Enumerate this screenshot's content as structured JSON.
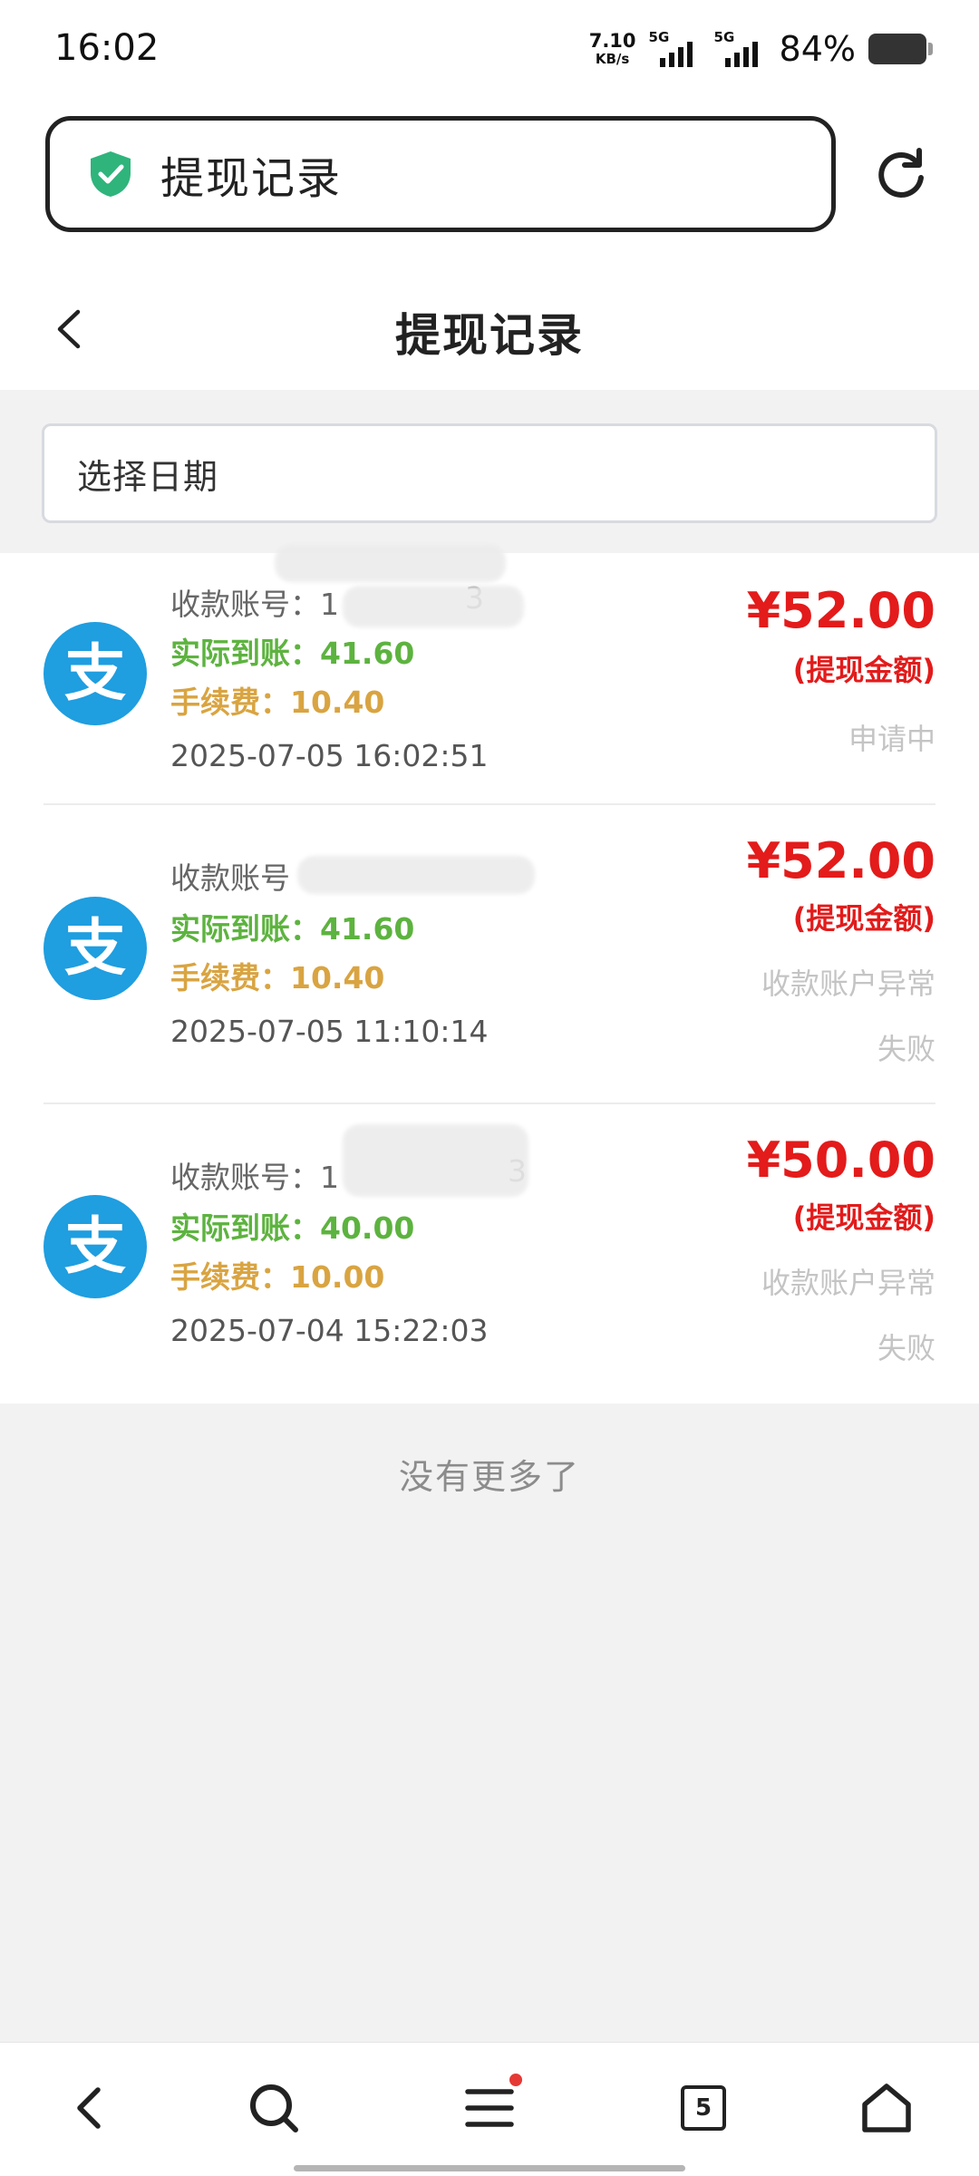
{
  "status_bar": {
    "time": "16:02",
    "net_speed_value": "7.10",
    "net_speed_unit": "KB/s",
    "sim1_label": "5G",
    "sim2_label": "5G",
    "battery_percent": "84%",
    "battery_level": 0.84
  },
  "browser": {
    "url_title": "提现记录",
    "security_icon": "shield-check-icon",
    "refresh_icon": "refresh-icon"
  },
  "header": {
    "title": "提现记录",
    "back_icon": "chevron-left-icon"
  },
  "filter": {
    "date_placeholder": "选择日期"
  },
  "records": [
    {
      "account_label": "收款账号",
      "account_visible": "：1",
      "account_tail": "3",
      "actual": "实际到账：41.60",
      "fee": "手续费：10.40",
      "time": "2025-07-05 16:02:51",
      "amount": "¥52.00",
      "amount_label": "(提现金额)",
      "status1": "申请中",
      "status2": ""
    },
    {
      "account_label": "收款账号",
      "account_visible": "",
      "account_tail": "",
      "actual": "实际到账：41.60",
      "fee": "手续费：10.40",
      "time": "2025-07-05 11:10:14",
      "amount": "¥52.00",
      "amount_label": "(提现金额)",
      "status1": "收款账户异常",
      "status2": "失败"
    },
    {
      "account_label": "收款账号",
      "account_visible": "：1",
      "account_tail": "3",
      "actual": "实际到账：40.00",
      "fee": "手续费：10.00",
      "time": "2025-07-04 15:22:03",
      "amount": "¥50.00",
      "amount_label": "(提现金额)",
      "status1": "收款账户异常",
      "status2": "失败"
    }
  ],
  "footer": {
    "no_more": "没有更多了"
  },
  "bottom_nav": {
    "tabs_count": "5",
    "menu_has_badge": true,
    "accent_badge_color": "#e53935"
  },
  "colors": {
    "amount_red": "#e31b1b",
    "actual_green": "#5db33f",
    "fee_orange": "#d9a441",
    "alipay_blue": "#1f9ee0",
    "shield_green": "#2fb47c"
  }
}
